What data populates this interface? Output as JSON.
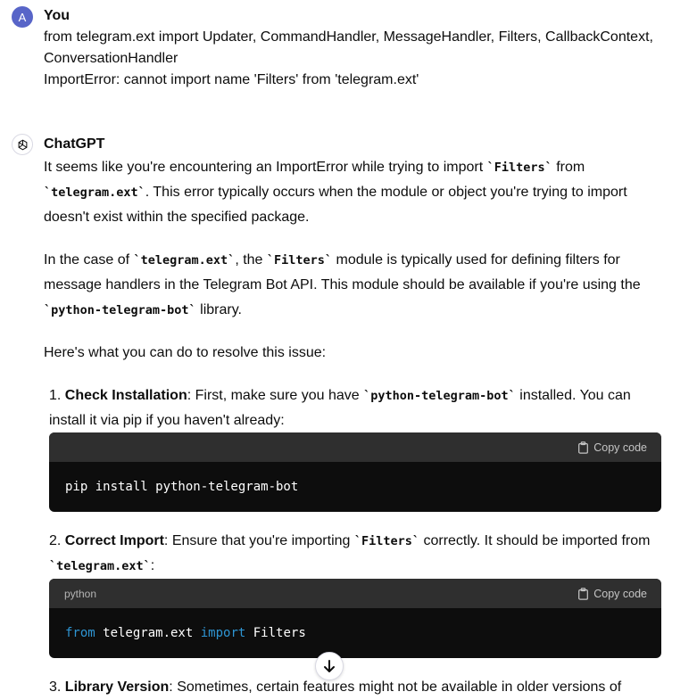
{
  "user": {
    "avatar_letter": "A",
    "name": "You",
    "lines": [
      "from telegram.ext import Updater, CommandHandler, MessageHandler, Filters, CallbackContext,",
      "ConversationHandler",
      "ImportError: cannot import name 'Filters' from 'telegram.ext'"
    ]
  },
  "assistant": {
    "name": "ChatGPT",
    "p1": {
      "a": "It seems like you're encountering an ImportError while trying to import ",
      "c1": "`Filters`",
      "b": " from ",
      "c2": "`telegram.ext`",
      "d": ". This error typically occurs when the module or object you're trying to import doesn't exist within the specified package."
    },
    "p2": {
      "a": "In the case of ",
      "c1": "`telegram.ext`",
      "b": ", the ",
      "c2": "`Filters`",
      "d": " module is typically used for defining filters for message handlers in the Telegram Bot API. This module should be available if you're using the ",
      "c3": "`python-telegram-bot`",
      "e": " library."
    },
    "p3": "Here's what you can do to resolve this issue:",
    "items": [
      {
        "num": "1.",
        "title": "Check Installation",
        "a": ": First, make sure you have ",
        "c1": "`python-telegram-bot`",
        "b": " installed. You can install it via pip if you haven't already:"
      },
      {
        "num": "2.",
        "title": "Correct Import",
        "a": ": Ensure that you're importing ",
        "c1": "`Filters`",
        "b": " correctly. It should be imported from ",
        "c2": "`telegram.ext`",
        "c": ":"
      },
      {
        "num": "3.",
        "title": "Library Version",
        "a": ": Sometimes, certain features might not be available in older versions of"
      }
    ],
    "code1": {
      "language": "",
      "copy_label": "Copy code",
      "code": "pip install python-telegram-bot"
    },
    "code2": {
      "language": "python",
      "copy_label": "Copy code",
      "kw1": "from",
      "mod": " telegram.ext ",
      "kw2": "import",
      "name": " Filters"
    }
  },
  "colors": {
    "user_avatar": "#5865c8",
    "code_bg": "#0d0d0d",
    "code_header": "#2f2f2f",
    "keyword": "#2e95d3"
  },
  "icons": [
    "openai-logo-icon",
    "clipboard-icon",
    "arrow-down-icon"
  ]
}
